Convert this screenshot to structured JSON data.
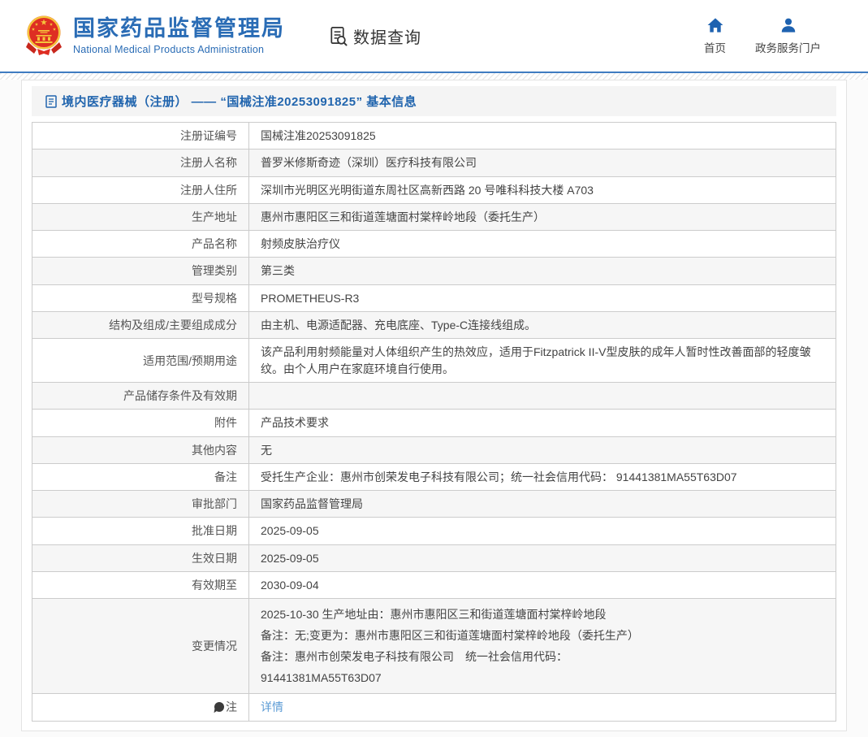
{
  "header": {
    "logo": {
      "title_cn": "国家药品监督管理局",
      "title_en": "National Medical Products Administration"
    },
    "data_query_label": "数据查询",
    "nav": [
      {
        "label": "首页",
        "icon": "home-icon"
      },
      {
        "label": "政务服务门户",
        "icon": "user-icon"
      }
    ]
  },
  "page": {
    "title": "境内医疗器械（注册） —— “国械注准20253091825” 基本信息"
  },
  "table": {
    "rows": [
      {
        "label": "注册证编号",
        "value": "国械注准20253091825"
      },
      {
        "label": "注册人名称",
        "value": "普罗米修斯奇迹（深圳）医疗科技有限公司"
      },
      {
        "label": "注册人住所",
        "value": "深圳市光明区光明街道东周社区高新西路 20 号唯科科技大楼 A703"
      },
      {
        "label": "生产地址",
        "value": "惠州市惠阳区三和街道莲塘面村棠梓岭地段（委托生产）"
      },
      {
        "label": "产品名称",
        "value": "射频皮肤治疗仪"
      },
      {
        "label": "管理类别",
        "value": "第三类"
      },
      {
        "label": "型号规格",
        "value": "PROMETHEUS-R3"
      },
      {
        "label": "结构及组成/主要组成成分",
        "value": "由主机、电源适配器、充电底座、Type-C连接线组成。"
      },
      {
        "label": "适用范围/预期用途",
        "value": "该产品利用射频能量对人体组织产生的热效应，适用于Fitzpatrick II-V型皮肤的成年人暂时性改善面部的轻度皱纹。由个人用户在家庭环境自行使用。"
      },
      {
        "label": "产品储存条件及有效期",
        "value": ""
      },
      {
        "label": "附件",
        "value": "产品技术要求"
      },
      {
        "label": "其他内容",
        "value": "无"
      },
      {
        "label": "备注",
        "value": "受托生产企业：惠州市创荣发电子科技有限公司；统一社会信用代码： 91441381MA55T63D07"
      },
      {
        "label": "审批部门",
        "value": "国家药品监督管理局"
      },
      {
        "label": "批准日期",
        "value": "2025-09-05"
      },
      {
        "label": "生效日期",
        "value": "2025-09-05"
      },
      {
        "label": "有效期至",
        "value": "2030-09-04"
      },
      {
        "label": "变更情况",
        "lines": [
          "2025-10-30 生产地址由：惠州市惠阳区三和街道莲塘面村棠梓岭地段",
          "备注：无;变更为：惠州市惠阳区三和街道莲塘面村棠梓岭地段（委托生产）",
          "备注：惠州市创荣发电子科技有限公司　统一社会信用代码：",
          "91441381MA55T63D07"
        ]
      },
      {
        "label": "注",
        "note": true,
        "link": "详情"
      }
    ]
  },
  "colors": {
    "brand_blue": "#2a6cb5",
    "title_blue": "#2165ae",
    "link_blue": "#5b9bd5",
    "line_blue": "#3f7cc1",
    "emblem_red": "#de2e23",
    "emblem_gold": "#f5c63c",
    "row_shade": "#f6f6f6",
    "border": "#cccccc"
  }
}
